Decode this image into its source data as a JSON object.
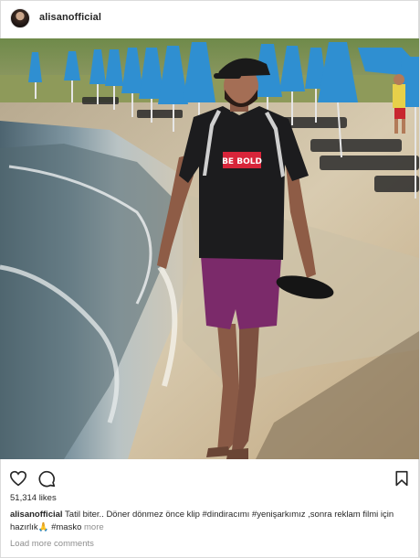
{
  "post": {
    "username": "alisanofficial",
    "likes_text": "51,314 likes",
    "caption": {
      "username": "alisanofficial",
      "text": "Tatil biter.. Döner dönmez önce klip #dindiracımı #yenişarkımız ,sonra reklam filmi için hazırlık🙏 #masko",
      "more_label": "more"
    },
    "load_more_label": "Load more comments",
    "shirt_text": "BE BOLD"
  },
  "icons": {
    "like": "heart-icon",
    "comment": "comment-icon",
    "save": "bookmark-icon"
  },
  "colors": {
    "text": "#262626",
    "muted": "#8e8e8e",
    "border": "#dbdbdb",
    "umbrella": "#2f8fd1",
    "shorts": "#7b2a6a",
    "shirt_badge": "#d8253a"
  }
}
